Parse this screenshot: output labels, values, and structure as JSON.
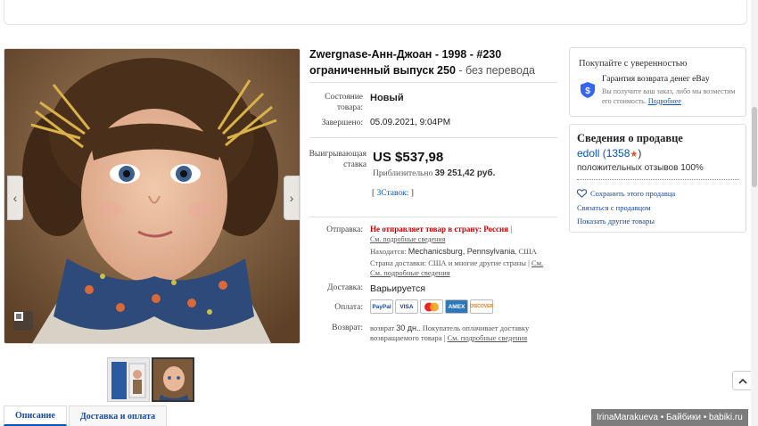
{
  "item": {
    "title_main": "Zwergnase-Анн-Джоан - 1998 - #230",
    "title_sub_bold": "ограниченный выпуск 250",
    "title_sub_rest": " - без перевода"
  },
  "details": {
    "condition_label": "Состояние товара:",
    "condition_value": "Новый",
    "ended_label": "Завершено:",
    "ended_value": "05.09.2021, 9:04PM",
    "winning_bid_label": "Выигрывающая ставка",
    "price": "US $537,98",
    "approx_prefix": "Приблизительно",
    "approx_value": "39 251,42 руб.",
    "bids_open": "[",
    "bids_count": "3",
    "bids_label": "Ставок:",
    "bids_close": "]"
  },
  "shipping": {
    "label": "Отправка:",
    "warning": "Не отправляет товар в страну: Россия",
    "pipe": "|",
    "details_link": "См. подробные сведения",
    "location_label": "Находится:",
    "location_value": "Mechanicsburg, Pennsylvania",
    "location_country": ", США",
    "country_label": "Страна доставки:",
    "country_value": "США и многие другие страны",
    "country_link": "См. подробные сведения",
    "delivery_label": "Доставка:",
    "delivery_value": "Варьируется"
  },
  "payment": {
    "label": "Оплата:",
    "methods": [
      "PayPal",
      "VISA",
      "MC",
      "AMEX",
      "DISCOVER"
    ]
  },
  "returns": {
    "label": "Возврат:",
    "line1_prefix": "возврат",
    "line1_days": "30 дн.",
    "line1_rest": ". Покупатель оплачивает доставку",
    "line2": "возвращаемого товара |",
    "link": "См. подробные сведения"
  },
  "guarantee": {
    "heading": "Покупайте с уверенностью",
    "title": "Гарантия возврата денег eBay",
    "text": "Вы получите ваш заказ, либо мы возместим его стоимость.",
    "link": "Подробнее"
  },
  "seller": {
    "heading": "Сведения о продавце",
    "name": "edoll",
    "count_open": "(1358",
    "star": "★",
    "count_close": ")",
    "feedback": "положительных отзывов 100%",
    "save_link": "Сохранить этого продавца",
    "contact_link": "Связаться с продавцом",
    "other_link": "Показать другие товары"
  },
  "tabs": [
    "Описание",
    "Доставка и оплата"
  ],
  "watermark": "IrinaMarakueva • Байбики • babiki.ru",
  "colors": {
    "link": "#0654ba",
    "warning": "#cc0000",
    "star": "#e0542b"
  }
}
